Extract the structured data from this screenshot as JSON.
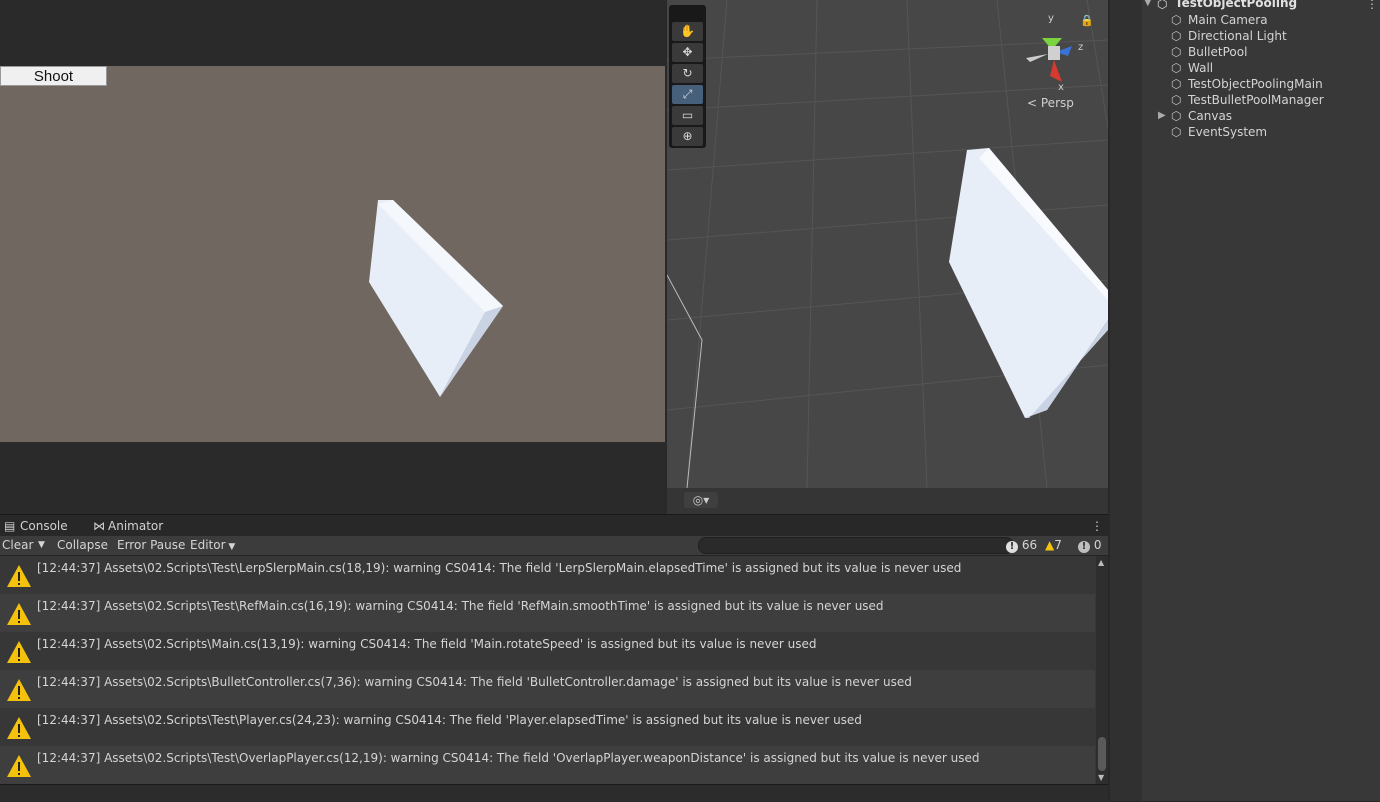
{
  "game": {
    "shoot_label": "Shoot"
  },
  "scene": {
    "persp_label": "Persp",
    "axis_y": "y",
    "axis_z": "z",
    "axis_x": "x",
    "tools": [
      "hand-icon",
      "move-icon",
      "rotate-icon",
      "scale-icon",
      "rect-icon",
      "transform-icon"
    ]
  },
  "hierarchy": {
    "scene_name": "TestObjectPooling",
    "items": [
      {
        "label": "Main Camera"
      },
      {
        "label": "Directional Light"
      },
      {
        "label": "BulletPool"
      },
      {
        "label": "Wall"
      },
      {
        "label": "TestObjectPoolingMain"
      },
      {
        "label": "TestBulletPoolManager"
      },
      {
        "label": "Canvas"
      },
      {
        "label": "EventSystem"
      }
    ]
  },
  "console": {
    "tabs": {
      "console": "Console",
      "animator": "Animator"
    },
    "toolbar": {
      "clear": "Clear",
      "collapse": "Collapse",
      "error_pause": "Error Pause",
      "editor": "Editor"
    },
    "search_placeholder": "",
    "counts": {
      "errors": "66",
      "warnings": "7",
      "info": "0"
    },
    "messages": [
      "[12:44:37] Assets\\02.Scripts\\Test\\LerpSlerpMain.cs(18,19): warning CS0414: The field 'LerpSlerpMain.elapsedTime' is assigned but its value is never used",
      "[12:44:37] Assets\\02.Scripts\\Test\\RefMain.cs(16,19): warning CS0414: The field 'RefMain.smoothTime' is assigned but its value is never used",
      "[12:44:37] Assets\\02.Scripts\\Main.cs(13,19): warning CS0414: The field 'Main.rotateSpeed' is assigned but its value is never used",
      "[12:44:37] Assets\\02.Scripts\\BulletController.cs(7,36): warning CS0414: The field 'BulletController.damage' is assigned but its value is never used",
      "[12:44:37] Assets\\02.Scripts\\Test\\Player.cs(24,23): warning CS0414: The field 'Player.elapsedTime' is assigned but its value is never used",
      "[12:44:37] Assets\\02.Scripts\\Test\\OverlapPlayer.cs(12,19): warning CS0414: The field 'OverlapPlayer.weaponDistance' is assigned but its value is never used"
    ]
  },
  "colors": {
    "warning_yellow": "#f4c20d",
    "active_tool": "#46607c"
  }
}
